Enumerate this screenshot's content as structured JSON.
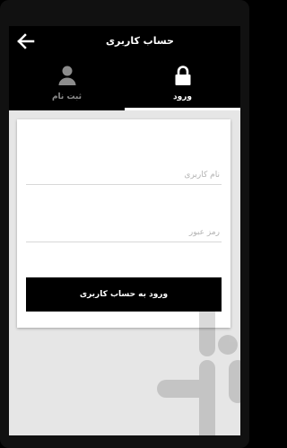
{
  "appbar": {
    "title": "حساب کاربری",
    "back_icon": "arrow-left-icon"
  },
  "tabs": [
    {
      "label": "ورود",
      "icon": "lock-icon",
      "active": true
    },
    {
      "label": "ثبت نام",
      "icon": "person-icon",
      "active": false
    }
  ],
  "form": {
    "username_placeholder": "نام کاربری",
    "username_value": "",
    "password_placeholder": "رمز عبور",
    "password_value": "",
    "submit_label": "ورود به حساب کاربری"
  },
  "colors": {
    "primary": "#000000",
    "background": "#e6e6e6",
    "card": "#ffffff",
    "inactive_tab": "#8c8c8c"
  }
}
